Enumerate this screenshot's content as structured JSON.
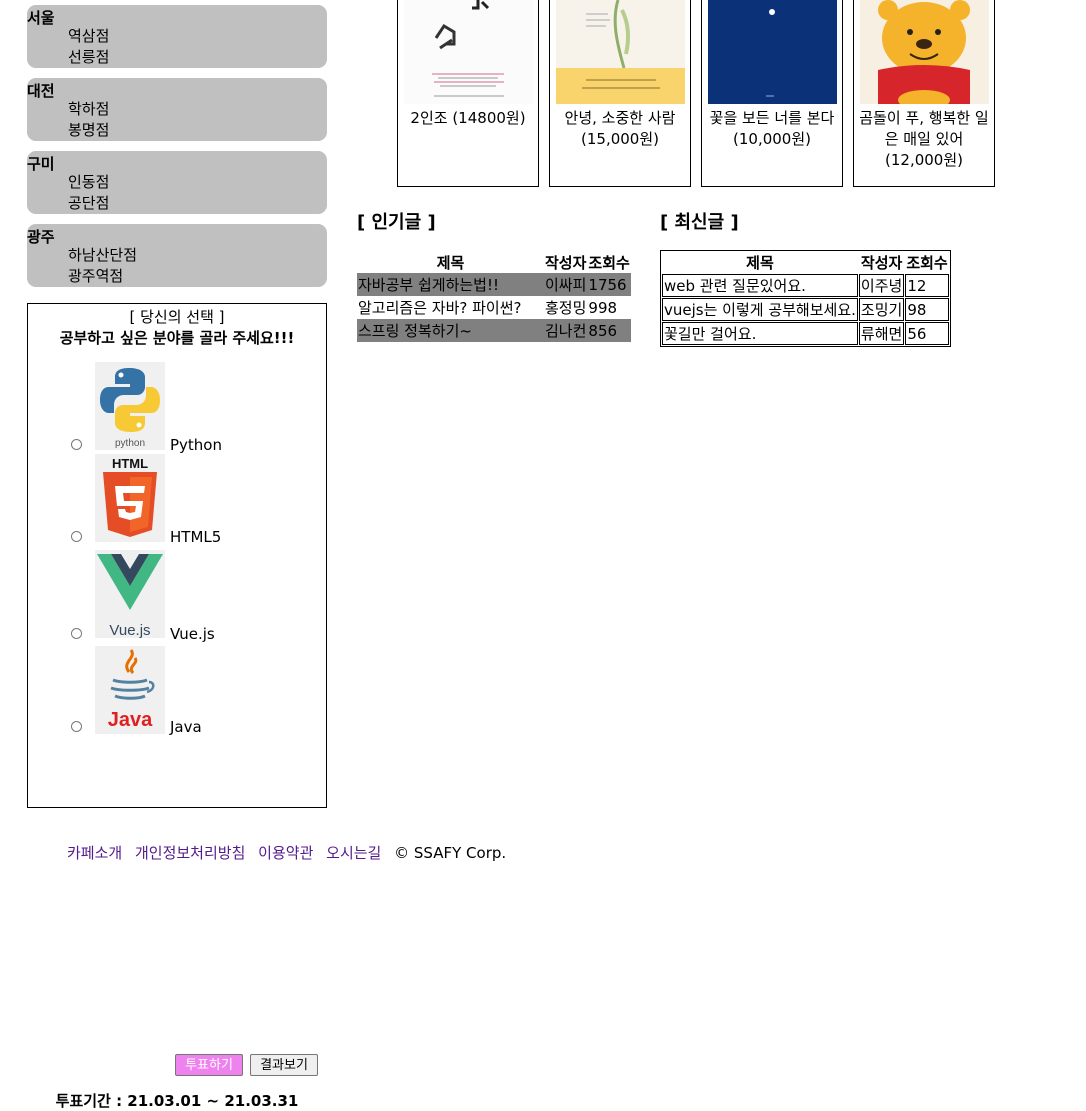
{
  "stores": [
    {
      "city": "서울",
      "branches": [
        "역삼점",
        "선릉점"
      ]
    },
    {
      "city": "대전",
      "branches": [
        "학하점",
        "봉명점"
      ]
    },
    {
      "city": "구미",
      "branches": [
        "인동점",
        "공단점"
      ]
    },
    {
      "city": "광주",
      "branches": [
        "하남산단점",
        "광주역점"
      ]
    }
  ],
  "vote": {
    "title": "[ 당신의 선택 ]",
    "subtitle": "공부하고 싶은 분야를 골라 주세요!!!",
    "options": [
      {
        "label": "Python",
        "icon": "python-logo-icon"
      },
      {
        "label": "HTML5",
        "icon": "html5-logo-icon"
      },
      {
        "label": "Vue.js",
        "icon": "vuejs-logo-icon"
      },
      {
        "label": "Java",
        "icon": "java-logo-icon"
      }
    ],
    "vote_button": "투표하기",
    "result_button": "결과보기",
    "period": "투표기간 : 21.03.01 ~ 21.03.31",
    "vote_button_color": "#ee82ee"
  },
  "books": [
    {
      "title": "2인조 (14800원)"
    },
    {
      "title": "안녕, 소중한 사람 (15,000원)"
    },
    {
      "title": "꽃을 보든 너를 본다 (10,000원)"
    },
    {
      "title": "곰돌이 푸, 행복한 일은 매일 있어 (12,000원)"
    }
  ],
  "popular": {
    "heading": "[ 인기글 ]",
    "columns": [
      "제목",
      "작성자",
      "조회수"
    ],
    "rows": [
      [
        "자바공부 쉽게하는법!!",
        "이싸피",
        "1756"
      ],
      [
        "알고리즘은 자바? 파이썬?",
        "홍정밍",
        "998"
      ],
      [
        "스프링 정복하기~",
        "김나컨",
        "856"
      ]
    ]
  },
  "recent": {
    "heading": "[ 최신글 ]",
    "columns": [
      "제목",
      "작성자",
      "조회수"
    ],
    "rows": [
      [
        "web 관련 질문있어요.",
        "이주녕",
        "12"
      ],
      [
        "vuejs는 이렇게 공부해보세요.",
        "조밍기",
        "98"
      ],
      [
        "꽃길만 걸어요.",
        "류해면",
        "56"
      ]
    ]
  },
  "footer": {
    "links": [
      "카페소개",
      "개인정보처리방침",
      "이용약관",
      "오시는길"
    ],
    "copyright": "© SSAFY Corp."
  }
}
